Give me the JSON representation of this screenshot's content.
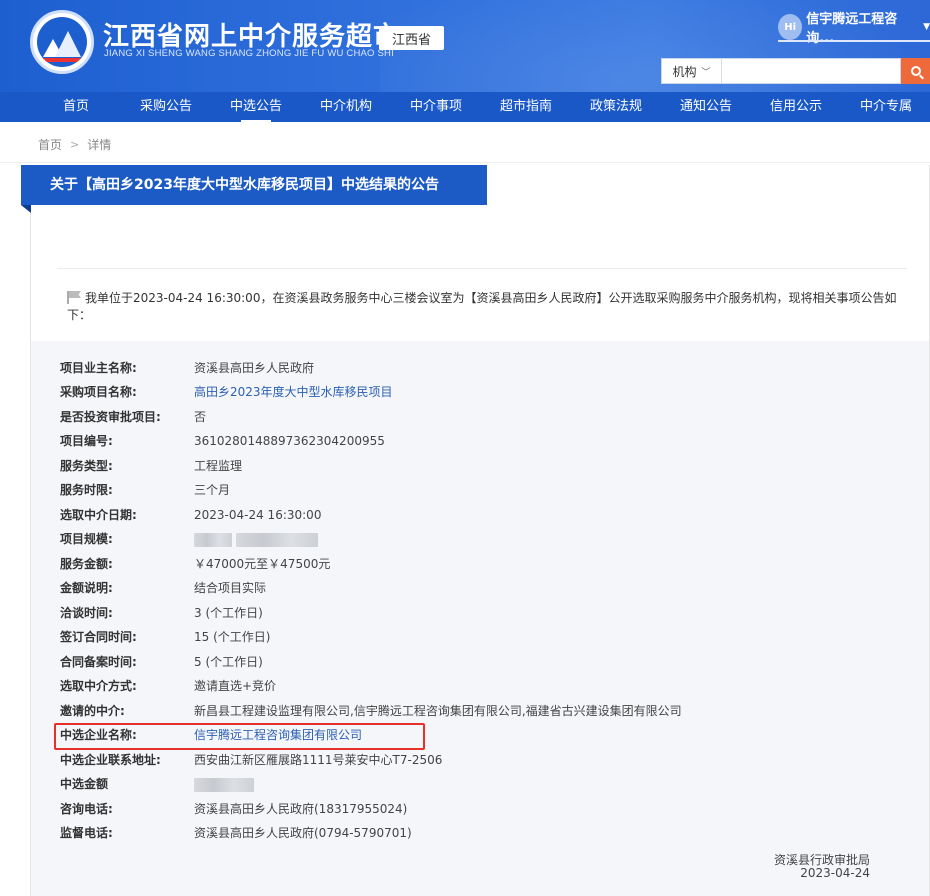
{
  "header": {
    "title": "江西省网上中介服务超市",
    "subtitle": "JIANG XI SHENG WANG SHANG ZHONG JIE FU WU CHAO SHI",
    "region": "江西省",
    "user": {
      "avatar_text": "Hi",
      "name": "信宇腾远工程咨询..."
    },
    "search": {
      "category": "机构",
      "placeholder": ""
    }
  },
  "nav": [
    "首页",
    "采购公告",
    "中选公告",
    "中介机构",
    "中介事项",
    "超市指南",
    "政策法规",
    "通知公告",
    "信用公示",
    "中介专属"
  ],
  "nav_active_index": 2,
  "breadcrumb": {
    "home": "首页",
    "current": "详情"
  },
  "notice": {
    "title": "关于【高田乡2023年度大中型水库移民项目】中选结果的公告",
    "intro": "我单位于2023-04-24 16:30:00，在资溪县政务服务中心三楼会议室为【资溪县高田乡人民政府】公开选取采购服务中介服务机构，现将相关事项公告如下："
  },
  "details": [
    {
      "label": "项目业主名称:",
      "value": "资溪县高田乡人民政府"
    },
    {
      "label": "采购项目名称:",
      "value": "高田乡2023年度大中型水库移民项目",
      "link": true
    },
    {
      "label": "是否投资审批项目:",
      "value": "否"
    },
    {
      "label": "项目编号:",
      "value": "361028014889736230420095​5"
    },
    {
      "label": "服务类型:",
      "value": "工程监理"
    },
    {
      "label": "服务时限:",
      "value": "三个月"
    },
    {
      "label": "选取中介日期:",
      "value": "2023-04-24 16:30:00"
    },
    {
      "label": "项目规模:",
      "value": ""
    },
    {
      "label": "服务金额:",
      "value": "￥47000元至￥47500元"
    },
    {
      "label": "金额说明:",
      "value": "结合项目实际"
    },
    {
      "label": "洽谈时间:",
      "value": "3 (个工作日)"
    },
    {
      "label": "签订合同时间:",
      "value": "15 (个工作日)"
    },
    {
      "label": "合同备案时间:",
      "value": "5 (个工作日)"
    },
    {
      "label": "选取中介方式:",
      "value": "邀请直选+竞价"
    },
    {
      "label": "邀请的中介:",
      "value": "新昌县工程建设监理有限公司,信宇腾远工程咨询集团有限公司,福建省古兴建设集团有限公司"
    },
    {
      "label": "中选企业名称:",
      "value": "信宇腾远工程咨询集团有限公司",
      "link": true
    },
    {
      "label": "中选企业联系地址:",
      "value": "西安曲江新区雁展路1111号莱安中心T7-2506"
    },
    {
      "label": "中选金额",
      "value": ""
    },
    {
      "label": "咨询电话:",
      "value": "资溪县高田乡人民政府(18317955024)"
    },
    {
      "label": "监督电话:",
      "value": "资溪县高田乡人民政府(0794-5790701)"
    }
  ],
  "signature": {
    "org": "资溪县行政审批局",
    "date": "2023-04-24"
  }
}
